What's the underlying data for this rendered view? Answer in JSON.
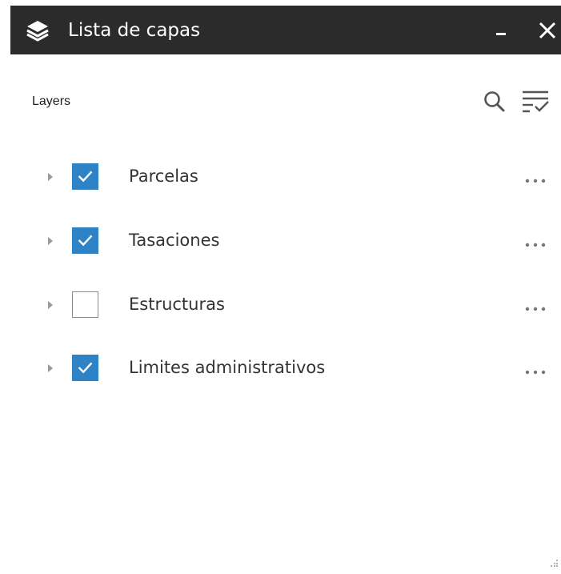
{
  "window": {
    "title": "Lista de capas",
    "title_icon": "layers-stack-icon",
    "minimize_icon": "minimize-icon",
    "close_icon": "close-icon"
  },
  "panel": {
    "header_label": "Layers",
    "search_icon": "search-icon",
    "filter_icon": "filter-list-icon"
  },
  "layers": [
    {
      "label": "Parcelas",
      "checked": true
    },
    {
      "label": "Tasaciones",
      "checked": true
    },
    {
      "label": "Estructuras",
      "checked": false
    },
    {
      "label": "Limites administrativos",
      "checked": true
    }
  ],
  "colors": {
    "titlebar": "#2b2b2b",
    "checkbox_checked": "#2d83c5",
    "checkbox_border": "#8a8a8a",
    "text": "#333333"
  }
}
